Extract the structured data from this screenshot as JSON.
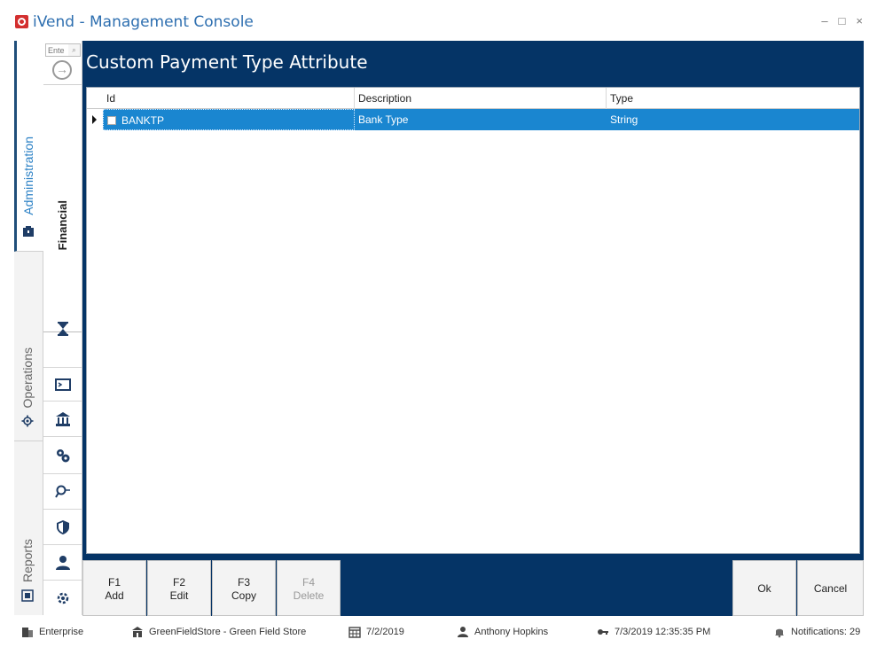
{
  "window": {
    "title": "iVend - Management Console",
    "minimize": "–",
    "maximize": "□",
    "close": "×"
  },
  "vertical_tabs": [
    {
      "label": "Administration",
      "icon": "admin-icon",
      "active": true
    },
    {
      "label": "Operations",
      "icon": "gear-icon",
      "active": false
    },
    {
      "label": "Reports",
      "icon": "report-icon",
      "active": false
    }
  ],
  "nav": {
    "search_placeholder": "Ente",
    "search_icon": "⌕",
    "go_icon": "→",
    "section_label": "Financial",
    "icons": [
      "hourglass-icon",
      "terminal-icon",
      "bank-icon",
      "gears-icon",
      "key-search-icon",
      "shield-icon",
      "user-icon",
      "settings-gear-icon"
    ]
  },
  "header": {
    "title": "Custom Payment Type Attribute"
  },
  "grid": {
    "columns": [
      "Id",
      "Description",
      "Type"
    ],
    "rows": [
      {
        "id": "BANKTP",
        "description": "Bank Type",
        "type": "String",
        "selected": true
      }
    ]
  },
  "footer": {
    "buttons": [
      {
        "key": "F1",
        "label": "Add",
        "enabled": true
      },
      {
        "key": "F2",
        "label": "Edit",
        "enabled": true
      },
      {
        "key": "F3",
        "label": "Copy",
        "enabled": true
      },
      {
        "key": "F4",
        "label": "Delete",
        "enabled": false
      }
    ],
    "ok_label": "Ok",
    "cancel_label": "Cancel"
  },
  "status": {
    "enterprise": "Enterprise",
    "store": "GreenFieldStore - Green Field Store",
    "date": "7/2/2019",
    "user": "Anthony Hopkins",
    "login_time": "7/3/2019 12:35:35 PM",
    "notifications": "Notifications: 29"
  },
  "colors": {
    "header_bg": "#053466",
    "selected_row": "#1a86d0",
    "title_text": "#2e6fb0",
    "app_logo": "#d32f2f"
  }
}
